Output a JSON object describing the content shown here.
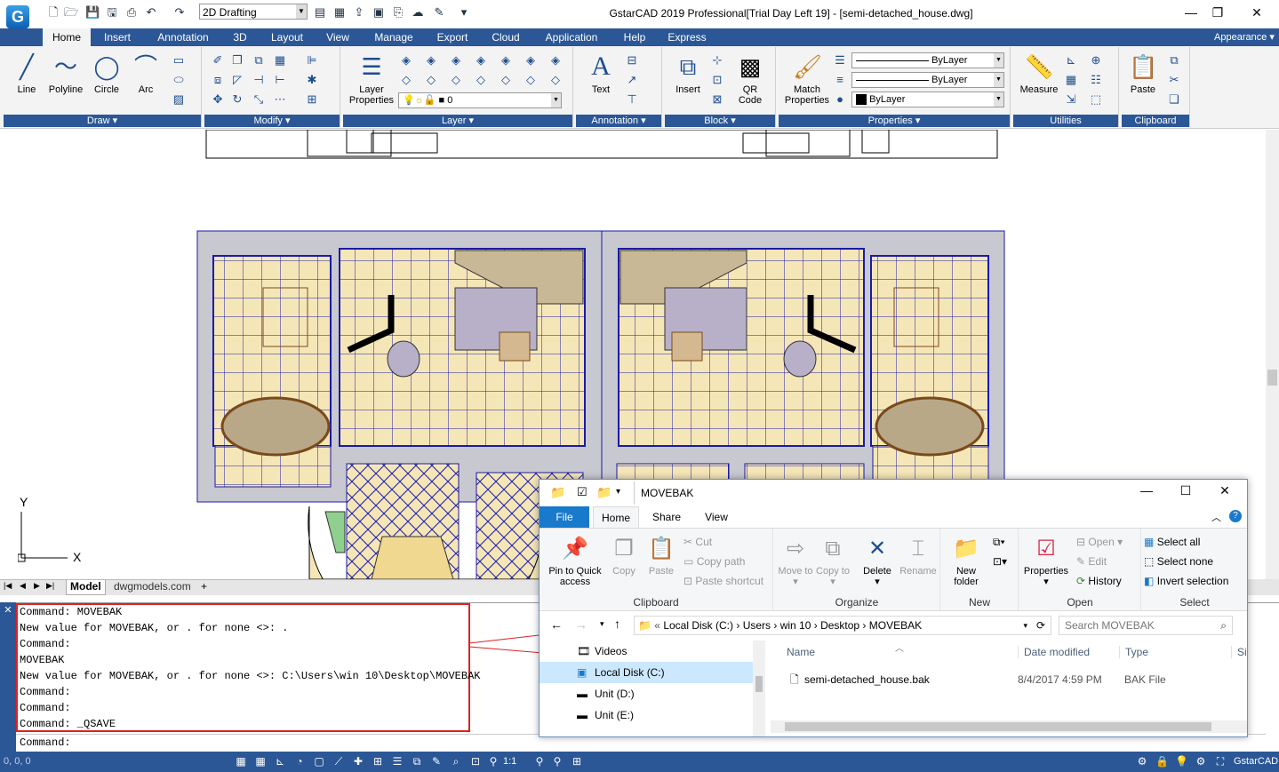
{
  "app": {
    "title": "GstarCAD 2019 Professional[Trial Day Left 19] - [semi-detached_house.dwg]",
    "logo": "G",
    "workspace": "2D Drafting",
    "appearance": "Appearance"
  },
  "ribbon_tabs": [
    "Home",
    "Insert",
    "Annotation",
    "3D",
    "Layout",
    "View",
    "Manage",
    "Export",
    "Cloud",
    "Application",
    "Help",
    "Express"
  ],
  "panels": {
    "draw": {
      "title": "Draw",
      "line": "Line",
      "polyline": "Polyline",
      "circle": "Circle",
      "arc": "Arc"
    },
    "modify": {
      "title": "Modify"
    },
    "layer": {
      "title": "Layer",
      "properties": "Layer Properties",
      "current": "0"
    },
    "annotation": {
      "title": "Annotation",
      "text": "Text"
    },
    "block": {
      "title": "Block",
      "insert": "Insert",
      "qr": "QR Code"
    },
    "properties": {
      "title": "Properties",
      "match": "Match Properties",
      "color": "ByLayer",
      "linetype": "ByLayer",
      "lineweight": "ByLayer"
    },
    "utilities": {
      "title": "Utilities",
      "measure": "Measure"
    },
    "clipboard": {
      "title": "Clipboard",
      "paste": "Paste"
    }
  },
  "layout_tabs": [
    "Model",
    "dwgmodels.com"
  ],
  "command_history": [
    "Command: MOVEBAK",
    "New value for MOVEBAK, or . for none <>: .",
    "Command:",
    "MOVEBAK",
    "New value for MOVEBAK, or . for none <>: C:\\Users\\win 10\\Desktop\\MOVEBAK",
    "Command:",
    "Command:",
    "Command: _QSAVE"
  ],
  "command_prompt": "Command:",
  "status": {
    "coords": "0, 0, 0",
    "scale": "1:1",
    "brand": "GstarCAD"
  },
  "explorer": {
    "title": "MOVEBAK",
    "tabs": [
      "File",
      "Home",
      "Share",
      "View"
    ],
    "clipboard": {
      "title": "Clipboard",
      "pin": "Pin to Quick access",
      "copy": "Copy",
      "paste": "Paste",
      "cut": "Cut",
      "copy_path": "Copy path",
      "paste_shortcut": "Paste shortcut"
    },
    "organize": {
      "title": "Organize",
      "move_to": "Move to",
      "copy_to": "Copy to",
      "delete": "Delete",
      "rename": "Rename"
    },
    "new": {
      "title": "New",
      "new_folder": "New folder"
    },
    "open": {
      "title": "Open",
      "properties": "Properties",
      "open": "Open",
      "edit": "Edit",
      "history": "History"
    },
    "select": {
      "title": "Select",
      "select_all": "Select all",
      "select_none": "Select none",
      "invert": "Invert selection"
    },
    "breadcrumb": [
      "Local Disk (C:)",
      "Users",
      "win 10",
      "Desktop",
      "MOVEBAK"
    ],
    "search_placeholder": "Search MOVEBAK",
    "nav_items": [
      "Videos",
      "Local Disk (C:)",
      "Unit (D:)",
      "Unit (E:)"
    ],
    "columns": [
      "Name",
      "Date modified",
      "Type",
      "Size"
    ],
    "files": [
      {
        "name": "semi-detached_house.bak",
        "date": "8/4/2017 4:59 PM",
        "type": "BAK File"
      }
    ]
  },
  "colors": {
    "accent": "#2b5797",
    "highlight_box": "#dd2222",
    "floor": "#f5e6b8",
    "grid_line": "#1a1aa8"
  }
}
